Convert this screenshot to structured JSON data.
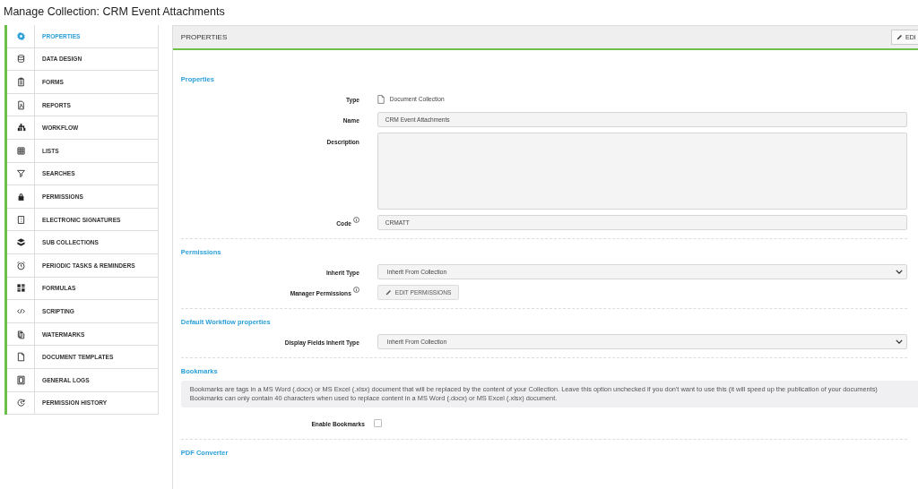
{
  "page_title": "Manage Collection: CRM Event Attachments",
  "sidebar": {
    "items": [
      {
        "label": "PROPERTIES",
        "selected": true
      },
      {
        "label": "DATA DESIGN",
        "selected": false
      },
      {
        "label": "FORMS",
        "selected": false
      },
      {
        "label": "REPORTS",
        "selected": false
      },
      {
        "label": "WORKFLOW",
        "selected": false
      },
      {
        "label": "LISTS",
        "selected": false
      },
      {
        "label": "SEARCHES",
        "selected": false
      },
      {
        "label": "PERMISSIONS",
        "selected": false
      },
      {
        "label": "ELECTRONIC SIGNATURES",
        "selected": false
      },
      {
        "label": "SUB COLLECTIONS",
        "selected": false
      },
      {
        "label": "PERIODIC TASKS & REMINDERS",
        "selected": false
      },
      {
        "label": "FORMULAS",
        "selected": false
      },
      {
        "label": "SCRIPTING",
        "selected": false
      },
      {
        "label": "WATERMARKS",
        "selected": false
      },
      {
        "label": "DOCUMENT TEMPLATES",
        "selected": false
      },
      {
        "label": "GENERAL LOGS",
        "selected": false
      },
      {
        "label": "PERMISSION HISTORY",
        "selected": false
      }
    ]
  },
  "panel": {
    "title": "PROPERTIES",
    "edit_button": "EDI"
  },
  "sections": [
    {
      "title": "Properties",
      "rows": [
        {
          "kind": "type",
          "label": "Type",
          "info": false,
          "value": "Document Collection"
        },
        {
          "kind": "input",
          "label": "Name",
          "info": false,
          "value": "CRM Event Attachments"
        },
        {
          "kind": "textarea",
          "label": "Description",
          "info": false
        },
        {
          "kind": "input",
          "label": "Code",
          "info": true,
          "value": "CRMATT"
        }
      ]
    },
    {
      "title": "Permissions",
      "rows": [
        {
          "kind": "select",
          "label": "Inherit Type",
          "info": false,
          "value": "Inherit From Collection"
        },
        {
          "kind": "button",
          "label": "Manager Permissions",
          "info": true,
          "value": "EDIT PERMISSIONS"
        }
      ]
    },
    {
      "title": "Default Workflow properties",
      "rows": [
        {
          "kind": "select",
          "label": "Display Fields Inherit Type",
          "info": false,
          "value": "Inherit From Collection"
        }
      ]
    },
    {
      "title": "Bookmarks",
      "notes": [
        "Bookmarks are tags in a MS Word (.docx) or MS Excel (.xlsx) document that will be replaced by the content of your Collection. Leave this option unchecked if you don't want to use this (it will speed up the publication of your documents)",
        "Bookmarks can only contain 40 characters when used to replace content in a MS Word (.docx) or MS Excel (.xlsx) document."
      ],
      "rows": [
        {
          "kind": "checkbox",
          "label": "Enable Bookmarks",
          "info": false,
          "checked": false
        }
      ]
    },
    {
      "title": "PDF Converter"
    }
  ]
}
